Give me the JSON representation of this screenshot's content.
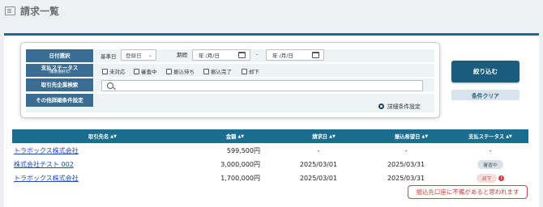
{
  "page": {
    "title": "請求一覧",
    "icon": "list-icon"
  },
  "filters": {
    "date_select": {
      "label": "日付選択",
      "base_label": "基準日",
      "base_value": "登録日",
      "period_label": "期間",
      "date_from": "年 /月/日",
      "date_to": "年 /月/日",
      "range_separator": "-"
    },
    "payment_status": {
      "label": "支払ステータス",
      "sub_label": "(複数選択可)",
      "options": [
        "未対応",
        "審査中",
        "振込待ち",
        "振込完了",
        "却下"
      ]
    },
    "partner_search": {
      "label": "取引先企業検索",
      "placeholder": ""
    },
    "other": {
      "label": "その他詳細条件設定",
      "detail_link": "詳細条件設定"
    }
  },
  "buttons": {
    "narrow": "絞り込む",
    "clear": "条件クリア"
  },
  "table": {
    "headers": [
      "取引先名",
      "金額",
      "請求日",
      "振込希望日",
      "支払ステータス"
    ],
    "rows": [
      {
        "partner": "トラボックス株式会社",
        "amount": "599,500円",
        "invoice_date": "-",
        "desired_date": "-",
        "status": "-",
        "status_type": "none"
      },
      {
        "partner": "株式会社テスト 002",
        "amount": "3,000,000円",
        "invoice_date": "2025/03/01",
        "desired_date": "2025/03/31",
        "status": "審査中",
        "status_type": "review"
      },
      {
        "partner": "トラボックス株式会社",
        "amount": "1,700,000円",
        "invoice_date": "2025/03/01",
        "desired_date": "2025/03/31",
        "status": "却下",
        "status_type": "reject"
      }
    ]
  },
  "tooltip": {
    "text": "振込先口座に不備があると思われます"
  },
  "colors": {
    "primary": "#1b6d8f",
    "label_bg": "#3b6d92",
    "button": "#1b5c7d",
    "link": "#1a4fb0",
    "error": "#d23b3b"
  }
}
